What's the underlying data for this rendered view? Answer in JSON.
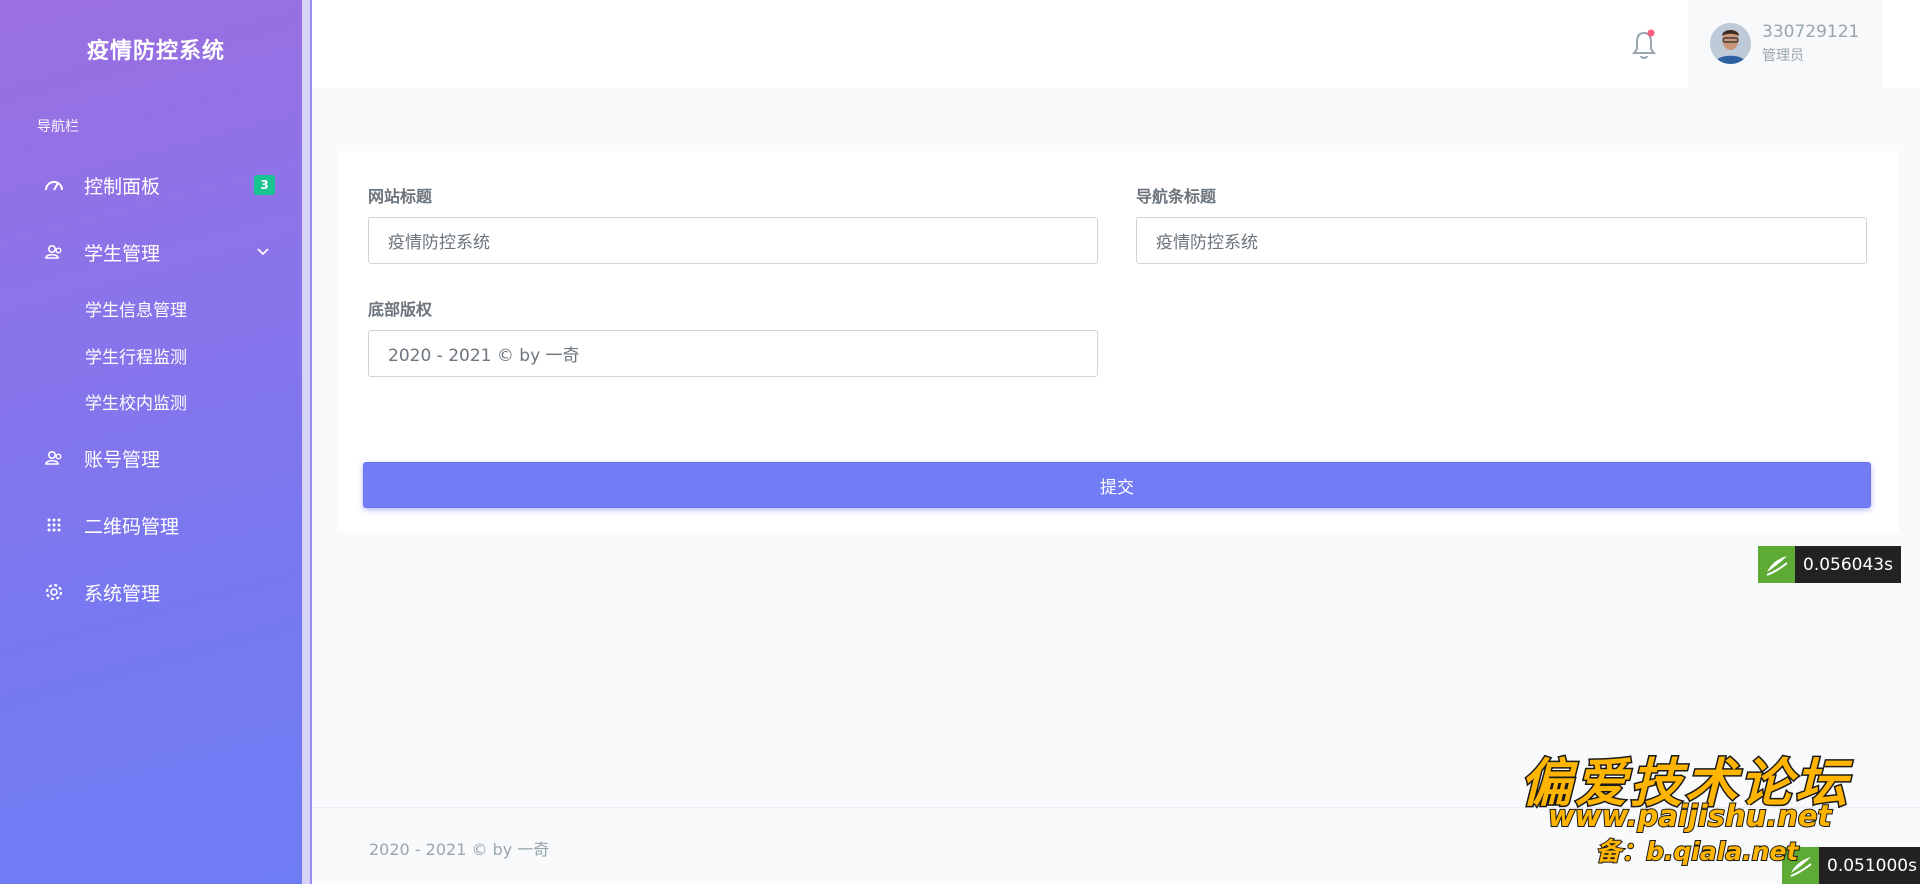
{
  "sidebar": {
    "brand": "疫情防控系统",
    "heading": "导航栏",
    "items": [
      {
        "label": "控制面板",
        "icon": "speedometer-icon",
        "badge": "3"
      },
      {
        "label": "学生管理",
        "icon": "users-icon",
        "expanded": true,
        "children": [
          "学生信息管理",
          "学生行程监测",
          "学生校内监测"
        ]
      },
      {
        "label": "账号管理",
        "icon": "users-icon"
      },
      {
        "label": "二维码管理",
        "icon": "grid-icon"
      },
      {
        "label": "系统管理",
        "icon": "gear-icon"
      }
    ]
  },
  "topbar": {
    "notification_icon": "bell-icon",
    "user": {
      "name": "330729121",
      "role": "管理员"
    }
  },
  "form": {
    "site_title": {
      "label": "网站标题",
      "value": "疫情防控系统"
    },
    "nav_title": {
      "label": "导航条标题",
      "value": "疫情防控系统"
    },
    "copyright": {
      "label": "底部版权",
      "value": "2020 - 2021 © by 一奇"
    },
    "submit_label": "提交"
  },
  "timers": [
    "0.056043s",
    "0.051000s"
  ],
  "footer": {
    "text": "2020 - 2021 © by 一奇"
  },
  "watermark": {
    "title": "偏爱技术论坛",
    "url": "www.paijishu.net",
    "sub": "备：b.qiala.net"
  },
  "colors": {
    "primary": "#727cf5",
    "badge": "#18c58f",
    "sidebar_top": "#9b6fe0",
    "sidebar_bottom": "#6f7df5"
  }
}
